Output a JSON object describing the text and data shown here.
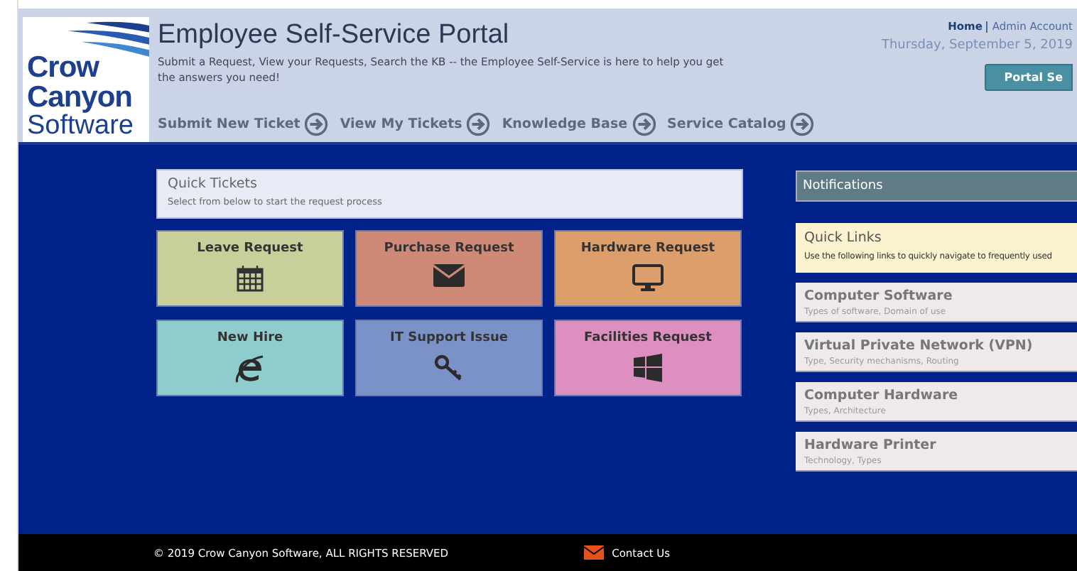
{
  "logo": {
    "lines": [
      "Crow",
      "Canyon",
      "Software"
    ]
  },
  "header": {
    "title": "Employee Self-Service Portal",
    "subtitle": "Submit a Request, View your Requests, Search the KB -- the Employee Self-Service is here to help you get the answers you need!",
    "nav": [
      "Submit New Ticket",
      "View My Tickets",
      "Knowledge Base",
      "Service Catalog"
    ],
    "top_links": [
      {
        "label": "Home",
        "selected": true
      },
      {
        "label": "Admin Account",
        "selected": false
      }
    ],
    "date": "Thursday, September 5, 2019",
    "button": "Portal Se"
  },
  "quick_tickets": {
    "title": "Quick Tickets",
    "subtitle": "Select from below to start the request process",
    "tiles": [
      {
        "label": "Leave Request",
        "kind": "calendar",
        "color": "#c8cf9a"
      },
      {
        "label": "Purchase Request",
        "kind": "envelope",
        "color": "#cf8a77"
      },
      {
        "label": "Hardware Request",
        "kind": "monitor",
        "color": "#dc9e6a"
      },
      {
        "label": "New Hire",
        "kind": "browser",
        "color": "#8fcdcc"
      },
      {
        "label": "IT Support Issue",
        "kind": "key",
        "color": "#7b92c8"
      },
      {
        "label": "Facilities Request",
        "kind": "windows",
        "color": "#dd90bf"
      }
    ]
  },
  "notifications": {
    "title": "Notifications"
  },
  "quick_links": {
    "title": "Quick Links",
    "subtitle": "Use the following links to quickly navigate to frequently used",
    "items": [
      {
        "title": "Computer Software",
        "subtitle": "Types of software, Domain of use"
      },
      {
        "title": "Virtual Private Network (VPN)",
        "subtitle": "Type, Security mechanisms, Routing"
      },
      {
        "title": "Computer Hardware",
        "subtitle": "Types, Architecture"
      },
      {
        "title": "Hardware Printer",
        "subtitle": "Technology, Types"
      }
    ]
  },
  "footer": {
    "copyright": "© 2019 Crow Canyon Software, ALL RIGHTS RESERVED",
    "contact": "Contact Us"
  }
}
